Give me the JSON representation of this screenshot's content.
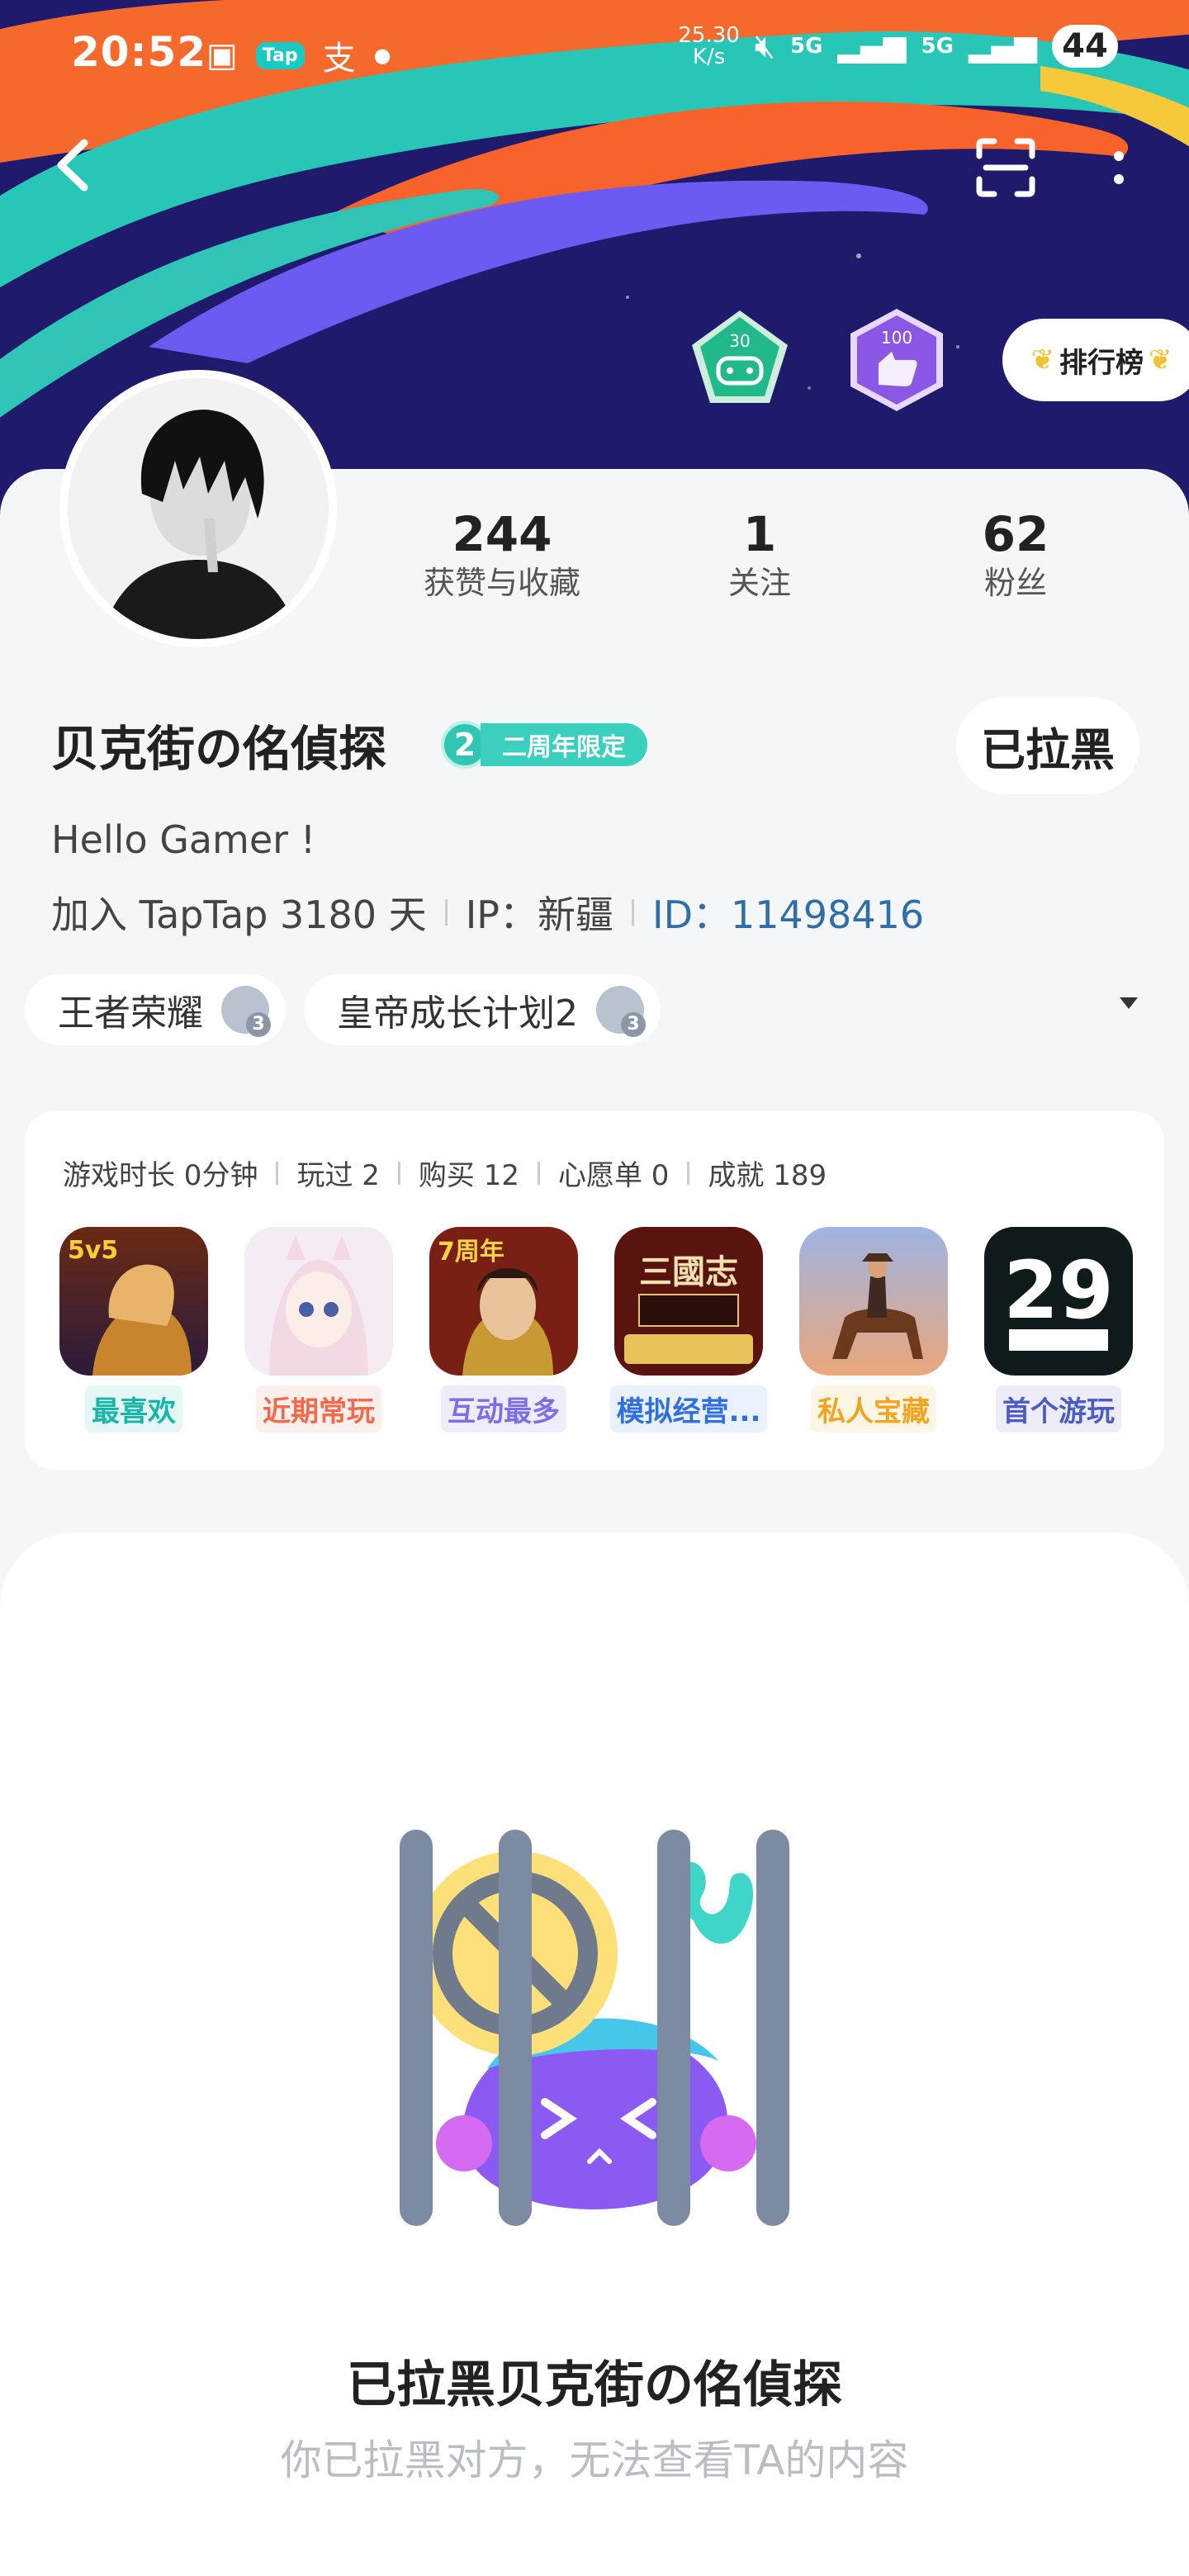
{
  "status_bar": {
    "time": "20:52",
    "net_speed_value": "25.30",
    "net_speed_unit": "K/s",
    "signal_1": "5G",
    "signal_2": "5G",
    "battery": "44"
  },
  "header": {
    "ranking_label": "排行榜",
    "badge_1": "30",
    "badge_2": "100"
  },
  "profile": {
    "stats": [
      {
        "value": "244",
        "label": "获赞与收藏"
      },
      {
        "value": "1",
        "label": "关注"
      },
      {
        "value": "62",
        "label": "粉丝"
      }
    ],
    "name": "贝克街の佲偵探",
    "anniversary_number": "2",
    "anniversary_label": "二周年限定",
    "blocked_button": "已拉黑",
    "bio": "Hello Gamer !",
    "join_days": "加入 TapTap 3180 天",
    "ip": "IP：新疆",
    "user_id": "ID：11498416",
    "tags": [
      "王者荣耀",
      "皇帝成长计划2"
    ]
  },
  "games": {
    "stats": [
      "游戏时长 0分钟",
      "玩过 2",
      "购买 12",
      "心愿单 0",
      "成就 189"
    ],
    "items": [
      {
        "label": "最喜欢",
        "color": "#17b6a8",
        "bg": "#e5f7f5",
        "icon_text": "5v5"
      },
      {
        "label": "近期常玩",
        "color": "#f26a4a",
        "bg": "#fdf0ec",
        "icon_text": ""
      },
      {
        "label": "互动最多",
        "color": "#7b6fe8",
        "bg": "#efedfd",
        "icon_text": "7周年"
      },
      {
        "label": "模拟经营...",
        "color": "#2f6fe0",
        "bg": "#e8f1fd",
        "icon_text": "三國志"
      },
      {
        "label": "私人宝藏",
        "color": "#f2a41e",
        "bg": "#fdf5e6",
        "icon_text": ""
      },
      {
        "label": "首个游玩",
        "color": "#4b5cc7",
        "bg": "#ecedf8",
        "icon_text": "29"
      }
    ]
  },
  "blocked": {
    "title": "已拉黑贝克街の佲偵探",
    "subtitle": "你已拉黑对方，无法查看TA的内容"
  }
}
